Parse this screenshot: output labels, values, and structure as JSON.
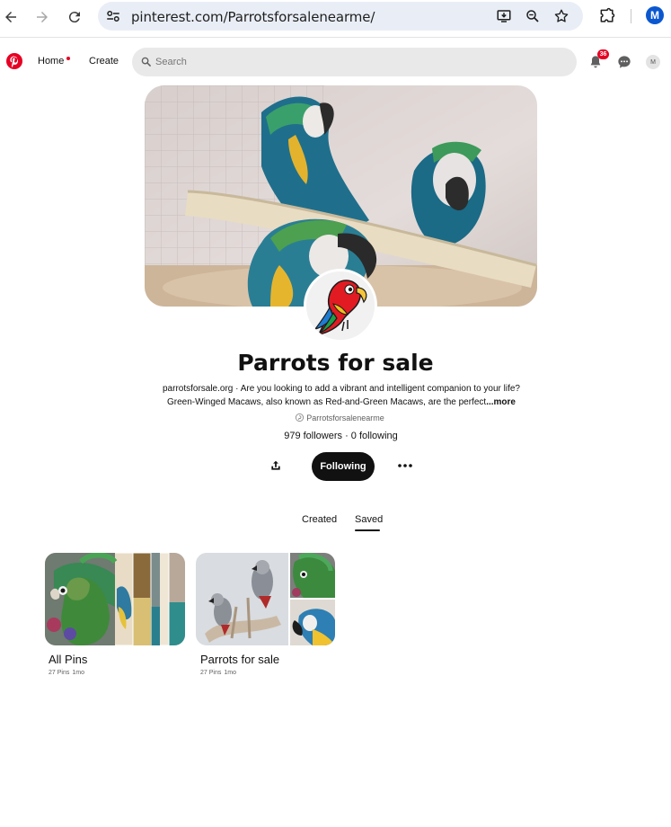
{
  "browser": {
    "url": "pinterest.com/Parrotsforsalenearme/",
    "profile_initial": "M"
  },
  "header": {
    "home_label": "Home",
    "create_label": "Create",
    "search_placeholder": "Search",
    "notification_count": "36",
    "user_initial": "M"
  },
  "profile": {
    "name": "Parrots for sale",
    "bio_line1": "parrotsforsale.org · Are you looking to add a vibrant and intelligent companion to your life?",
    "bio_line2": "Green-Winged Macaws, also known as Red-and-Green Macaws, are the perfect",
    "bio_more": "...more",
    "handle": "Parrotsforsalenearme",
    "stats": "979 followers · 0 following",
    "following_label": "Following"
  },
  "tabs": [
    {
      "label": "Created",
      "active": false
    },
    {
      "label": "Saved",
      "active": true
    }
  ],
  "boards": [
    {
      "title": "All Pins",
      "pins": "27 Pins",
      "age": "1mo"
    },
    {
      "title": "Parrots for sale",
      "pins": "27 Pins",
      "age": "1mo"
    }
  ],
  "colors": {
    "accent": "#e60023",
    "button_dark": "#111111",
    "chrome_avatar": "#0b57d0"
  }
}
